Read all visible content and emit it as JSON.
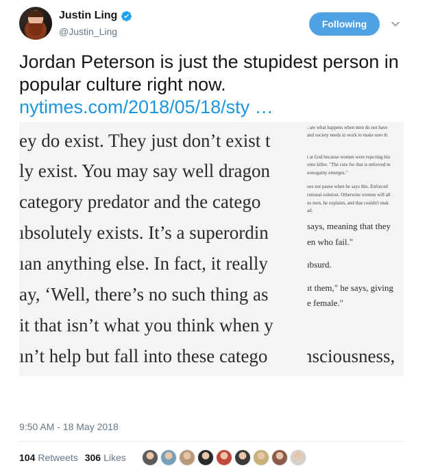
{
  "author": {
    "name": "Justin Ling",
    "handle": "@Justin_Ling",
    "verified": true
  },
  "follow_button": {
    "label": "Following",
    "color": "#4ea2e4"
  },
  "menu": {
    "icon": "chevron-down-icon"
  },
  "tweet": {
    "text": "Jordan Peterson is just the stupidest person in popular culture right now.",
    "link": "nytimes.com/2018/05/18/sty …",
    "link_color": "#1b95e0"
  },
  "media": {
    "lines": [
      "ey do exist. They just don’t exist t",
      "ly exist. You may say well dragon",
      "category predator and the catego",
      "ıbsolutely exists. It’s a superordin",
      "ıan anything else. In fact, it really",
      "ay, ‘Well, there’s no such thing as",
      "it that isn’t what you think when y",
      "ın’t help but fall into these catego"
    ],
    "right_small_lines": [
      "; are what happens when men do not have",
      "and society needs to work to make sure th",
      "t at God because women were rejecting hin",
      "onto killer. \"The cure for that is enforced m",
      "nonogamy emerges.\"",
      "oes not pause when he says this. Enforced",
      "rational solution. Otherwise women will all",
      "us men, he explains, and that couldn't mak",
      "ad."
    ],
    "right_mid_lines": [
      " says, meaning that they",
      "en who fail.\"",
      "ıbsurd.",
      "ıt them,\" he says, giving",
      "e female.\"",
      "nsciousness,"
    ]
  },
  "timestamp": "9:50 AM - 18 May 2018",
  "stats": {
    "retweets_count": "104",
    "retweets_label": "Retweets",
    "likes_count": "306",
    "likes_label": "Likes"
  },
  "likers": [
    {
      "color": "#5a5a5a"
    },
    {
      "color": "#7aa0b8"
    },
    {
      "color": "#b89a7a"
    },
    {
      "color": "#2a2a2a"
    },
    {
      "color": "#c0483a"
    },
    {
      "color": "#3a3a3a"
    },
    {
      "color": "#c8b07a"
    },
    {
      "color": "#8a5a4a"
    },
    {
      "color": "#d8d0c8"
    }
  ]
}
